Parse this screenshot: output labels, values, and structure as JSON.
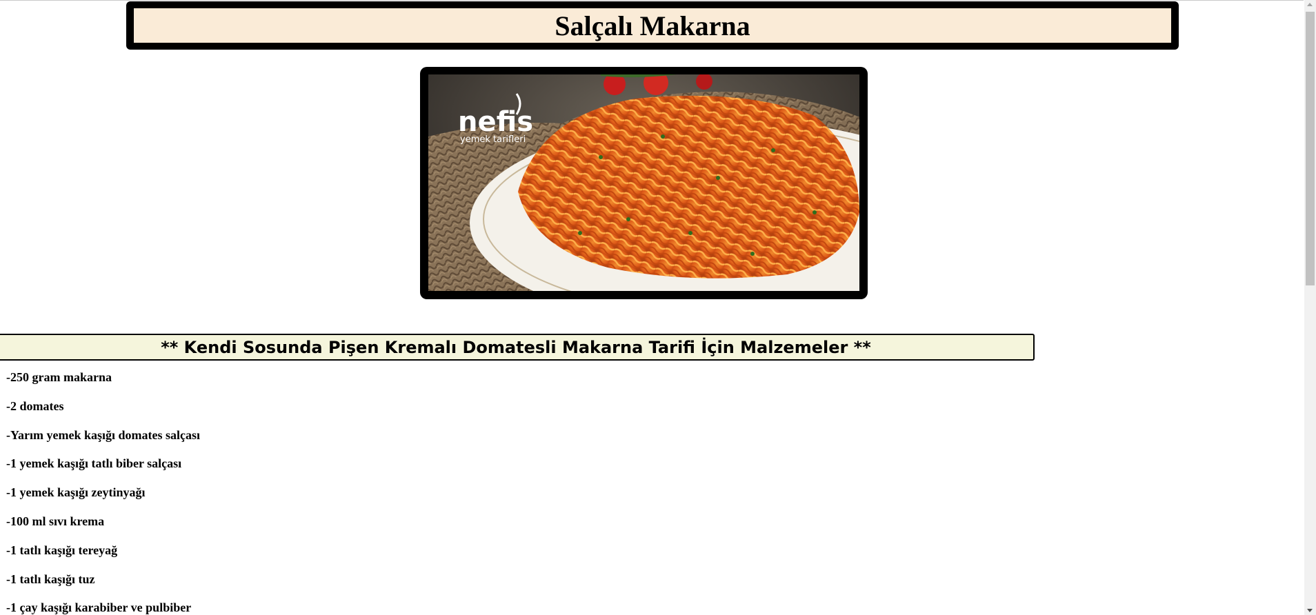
{
  "header": {
    "title": "Salçalı Makarna"
  },
  "photo": {
    "logo_word": "nefis",
    "logo_sub": "yemek tarifleri"
  },
  "section": {
    "heading": "** Kendi Sosunda Pişen Kremalı Domatesli Makarna Tarifi İçin Malzemeler **"
  },
  "ingredients": [
    "-250 gram makarna",
    "-2 domates",
    "-Yarım yemek kaşığı domates salçası",
    "-1 yemek kaşığı tatlı biber salçası",
    "-1 yemek kaşığı zeytinyağı",
    "-100 ml sıvı krema",
    "-1 tatlı kaşığı tereyağ",
    "-1 tatlı kaşığı tuz",
    "-1 çay kaşığı karabiber ve pulbiber"
  ],
  "colors": {
    "title_background": "#faebd7",
    "heading_background": "#f5f5dc",
    "frame": "#000000"
  }
}
